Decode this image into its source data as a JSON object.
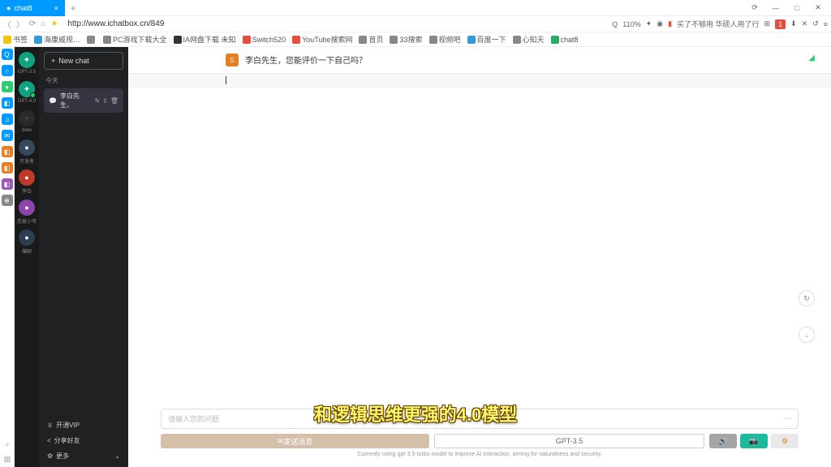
{
  "titlebar": {
    "tab_title": "chat8",
    "win": {
      "cloud": "⟳",
      "min": "—",
      "max": "□",
      "close": "✕"
    }
  },
  "addressbar": {
    "url": "http://www.ichatbox.cn/849",
    "zoom": "110%",
    "promo": "买了不够用 华硕人用了行",
    "q": "Q"
  },
  "bookmarks": [
    {
      "label": "书签",
      "color": "#f1c40f"
    },
    {
      "label": "海康威视…",
      "color": "#3498db"
    },
    {
      "label": "",
      "color": "#888"
    },
    {
      "label": "PC游戏下载大全",
      "color": "#888"
    },
    {
      "label": "IA网盘下载 未知",
      "color": "#333"
    },
    {
      "label": "Switch520",
      "color": "#e74c3c"
    },
    {
      "label": "YouTube搜索网",
      "color": "#e74c3c"
    },
    {
      "label": "首页",
      "color": "#888"
    },
    {
      "label": "33搜索",
      "color": "#888"
    },
    {
      "label": "视频吧",
      "color": "#888"
    },
    {
      "label": "百度一下",
      "color": "#3498db"
    },
    {
      "label": "心知天",
      "color": "#888"
    },
    {
      "label": "chat8",
      "color": "#27ae60"
    }
  ],
  "dock": [
    {
      "color": "#0099ff",
      "txt": "Q"
    },
    {
      "color": "#0099ff",
      "txt": "○"
    },
    {
      "color": "#2ecc71",
      "txt": "●"
    },
    {
      "color": "#0099ff",
      "txt": "◧"
    },
    {
      "color": "#0099ff",
      "txt": "♫"
    },
    {
      "color": "#0099ff",
      "txt": "✉"
    },
    {
      "color": "#e67e22",
      "txt": "◧"
    },
    {
      "color": "#e67e22",
      "txt": "◧"
    },
    {
      "color": "#9b59b6",
      "txt": "◧"
    },
    {
      "color": "#888",
      "txt": "⊕"
    }
  ],
  "models": [
    {
      "label": "GPT-3.5",
      "active": false
    },
    {
      "label": "GPT-4.0",
      "active": true
    }
  ],
  "beta_label": "beta",
  "personas": [
    {
      "label": "开发者",
      "bg": "#34495e"
    },
    {
      "label": "李白",
      "bg": "#c0392b"
    },
    {
      "label": "恋爱小可",
      "bg": "#8e44ad"
    },
    {
      "label": "编剧",
      "bg": "#2c3e50"
    }
  ],
  "convo": {
    "new_chat": "New chat",
    "section": "今天",
    "item": "李白先生，",
    "footer": [
      "开通VIP",
      "分享好友",
      "更多"
    ]
  },
  "chat": {
    "user_msg": "李白先生，您能评价一下自己吗？",
    "user_badge": "5",
    "input_placeholder": "请输入您的问题",
    "send_btn": "发送消息",
    "model_btn": "GPT-3.5",
    "status": "Currently using gpt-3.5-turbo model to improve AI interaction, aiming for naturalness and security.",
    "regen": "↻",
    "scroll": "↓",
    "dots": "⋯"
  },
  "subtitle": "和逻辑思维更强的4.0模型"
}
